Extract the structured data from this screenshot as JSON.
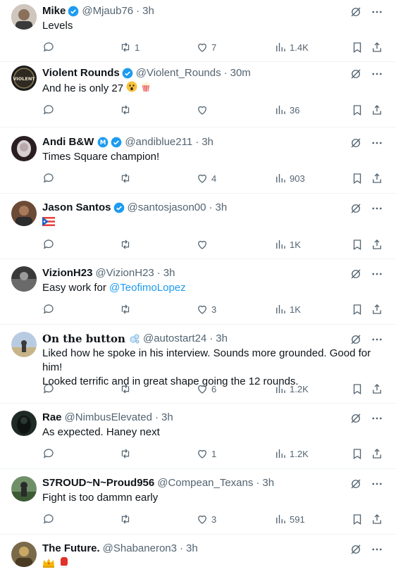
{
  "tweets": [
    {
      "name": "Mike",
      "verified": "blue",
      "handle": "@Mjaub76",
      "time": "3h",
      "text": "Levels",
      "replies": "",
      "retweets": "1",
      "likes": "7",
      "views": "1.4K",
      "avatar_color": "#8a7a6a"
    },
    {
      "name": "Violent Rounds",
      "verified": "blue",
      "handle": "@Violent_Rounds",
      "time": "30m",
      "text": "And he is only 27",
      "emojis": [
        "astonished-face-emoji",
        "popcorn-emoji"
      ],
      "replies": "",
      "retweets": "",
      "likes": "",
      "views": "36",
      "avatar_color": "#2b2b2b",
      "avatar_text": "VIOLENT"
    },
    {
      "name": "Andi B&W",
      "verified": "m-badge",
      "handle": "@andiblue211",
      "time": "3h",
      "text": "Times Square champion!",
      "replies": "",
      "retweets": "",
      "likes": "4",
      "views": "903",
      "avatar_color": "#3a2a2e"
    },
    {
      "name": "Jason Santos",
      "verified": "blue",
      "handle": "@santosjason00",
      "time": "3h",
      "text": "",
      "emojis": [
        "puerto-rico-flag-emoji"
      ],
      "replies": "",
      "retweets": "",
      "likes": "",
      "views": "1K",
      "avatar_color": "#6b4a36"
    },
    {
      "name": "VizionH23",
      "verified": "",
      "handle": "@VizionH23",
      "time": "3h",
      "text": "Easy work for ",
      "mention": "@TeofimoLopez",
      "replies": "",
      "retweets": "",
      "likes": "3",
      "views": "1K",
      "avatar_color": "#4d4d4d"
    },
    {
      "name": "On the button",
      "verified": "",
      "handle": "@autostart24",
      "time": "3h",
      "text_lines": [
        "Liked how he spoke in his interview. Sounds more grounded. Good for him!",
        "Looked terrific and in great shape going the 12 rounds."
      ],
      "replies": "",
      "retweets": "",
      "likes": "6",
      "views": "1.2K",
      "avatar_color": "#b9a88a"
    },
    {
      "name": "Rae",
      "verified": "",
      "handle": "@NimbusElevated",
      "time": "3h",
      "text": "As expected. Haney next",
      "replies": "",
      "retweets": "",
      "likes": "1",
      "views": "1.2K",
      "avatar_color": "#1f2a26"
    },
    {
      "name": "S7ROUD~N~Proud956",
      "verified": "",
      "handle": "@Compean_Texans",
      "time": "3h",
      "text": "Fight is too dammn early",
      "replies": "",
      "retweets": "",
      "likes": "3",
      "views": "591",
      "avatar_color": "#4f6a48"
    },
    {
      "name": "The Future.",
      "verified": "",
      "handle": "@Shabaneron3",
      "time": "3h",
      "text": "",
      "emojis": [
        "crown-emoji",
        "boxing-glove-emoji"
      ],
      "avatar_color": "#7a6a4a"
    }
  ],
  "colors": {
    "accent": "#1d9bf0",
    "text": "#0f1419",
    "muted": "#536471",
    "divider": "#eff3f4"
  }
}
